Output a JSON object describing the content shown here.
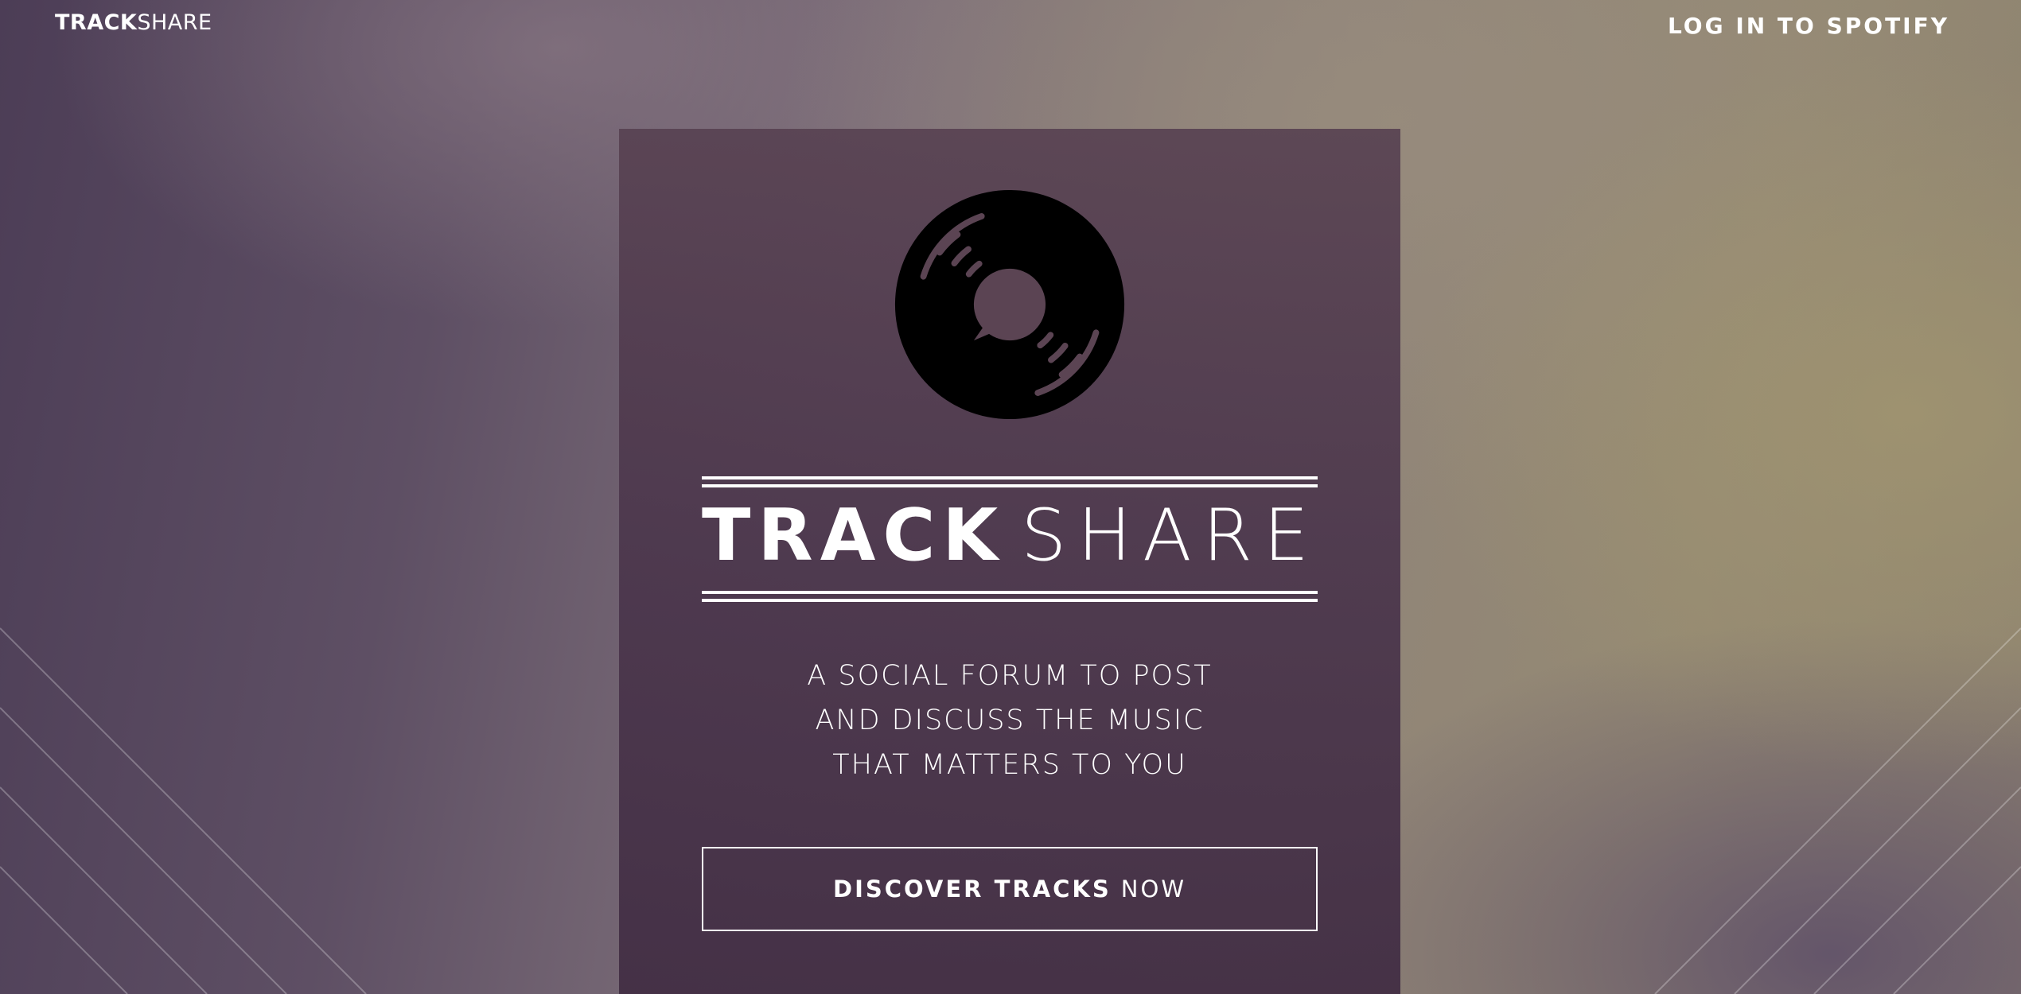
{
  "header": {
    "brand_bold": "TRACK",
    "brand_light": "SHARE",
    "login_label": "LOG IN TO SPOTIFY"
  },
  "hero": {
    "logo_icon": "vinyl-record-speech-bubble-icon",
    "title_bold": "TRACK",
    "title_light": "SHARE",
    "tagline_lines": [
      "A SOCIAL FORUM TO POST",
      "AND DISCUSS THE MUSIC",
      "THAT MATTERS TO YOU"
    ],
    "cta_bold": "DISCOVER TRACKS",
    "cta_light": "NOW"
  },
  "colors": {
    "card_background": "#4f3a50",
    "text": "#ffffff",
    "logo_fill": "#000000"
  }
}
